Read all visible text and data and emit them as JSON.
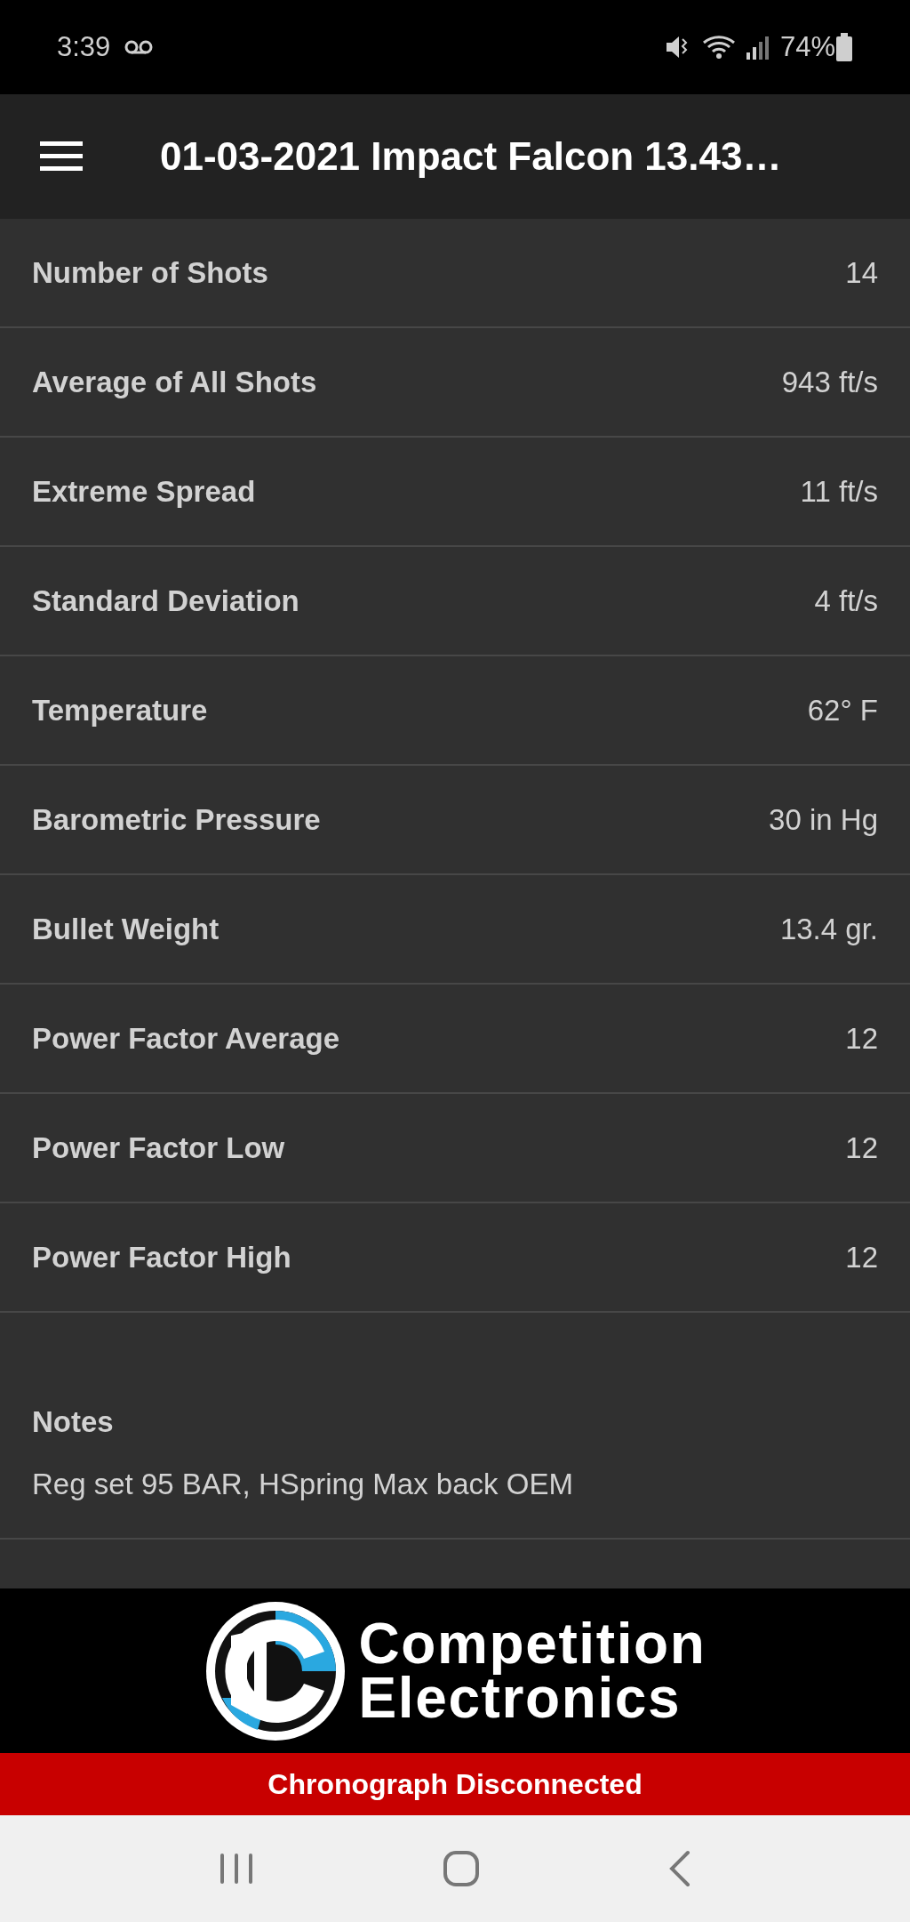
{
  "status_bar": {
    "time": "3:39",
    "battery": "74%"
  },
  "header": {
    "title": "01-03-2021 Impact Falcon 13.43…"
  },
  "stats": [
    {
      "label": "Number of Shots",
      "value": "14"
    },
    {
      "label": "Average of All Shots",
      "value": "943 ft/s"
    },
    {
      "label": "Extreme Spread",
      "value": "11 ft/s"
    },
    {
      "label": "Standard Deviation",
      "value": "4 ft/s"
    },
    {
      "label": "Temperature",
      "value": "62° F"
    },
    {
      "label": "Barometric Pressure",
      "value": "30 in Hg"
    },
    {
      "label": "Bullet Weight",
      "value": "13.4 gr."
    },
    {
      "label": "Power Factor Average",
      "value": "12"
    },
    {
      "label": "Power Factor Low",
      "value": "12"
    },
    {
      "label": "Power Factor High",
      "value": "12"
    }
  ],
  "notes": {
    "label": "Notes",
    "text": "Reg set 95 BAR, HSpring Max back OEM"
  },
  "logo": {
    "line_1": "Competition",
    "line_2": "Electronics"
  },
  "connection_banner": {
    "text": "Chronograph Disconnected"
  }
}
